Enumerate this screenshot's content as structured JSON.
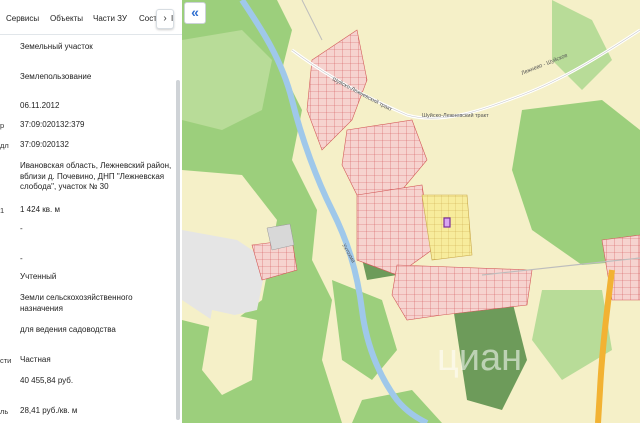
{
  "tabs": [
    "Сервисы",
    "Объекты",
    "Части ЗУ",
    "Соста"
  ],
  "tabs_next_icon": "chevron-right-icon",
  "tabs_more_fragment": "І",
  "label_stubs": [
    "р",
    "дл",
    "1",
    "сти",
    "ль"
  ],
  "fields": {
    "type": "Земельный участок",
    "kind": "Землепользование",
    "date": "06.11.2012",
    "cad_number": "37:09:020132:379",
    "cad_quarter": "37:09:020132",
    "address": "Ивановская область, Лежневский район, вблизи д. Почевино, ДНП \"Лежневская слобода\", участок № 30",
    "area": "1 424 кв. м",
    "dash1": "-",
    "dash2": "-",
    "status": "Учтенный",
    "category": "Земли сельскохозяйственного назначения",
    "use": "для ведения садоводства",
    "ownership": "Частная",
    "cad_value": "40 455,84 руб.",
    "unit_value": "28,41 руб./кв. м"
  },
  "map": {
    "collapse_icon": "double-chevron-left-icon",
    "road_labels": [
      "Шуйско-Лежневский тракт",
      "Лежнево - Шуйское",
      "Шуйско-Лежневский тракт"
    ],
    "river_label": "Ухтохма",
    "colors": {
      "field": "#f5f0c8",
      "forest": "#9ccf7c",
      "forest_light": "#b8dc98",
      "river": "#9fc8ea",
      "parcel": "#f6d3cf",
      "parcel_stroke": "#d35a5a",
      "selected_parcel": "#7a2f9b",
      "highway": "#f2b233"
    }
  },
  "watermark_text": "циан"
}
